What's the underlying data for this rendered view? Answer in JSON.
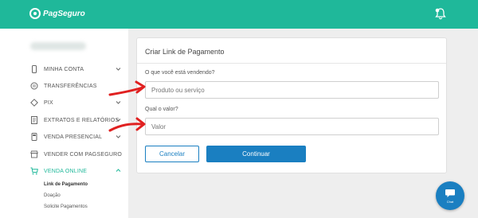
{
  "header": {
    "logo_text": "PagSeguro",
    "accent_color": "#1fb89a",
    "notification_icon": "bell-icon"
  },
  "sidebar": {
    "items": [
      {
        "label": "MINHA CONTA",
        "icon": "phone-icon",
        "has_chevron": true
      },
      {
        "label": "TRANSFERÊNCIAS",
        "icon": "transfer-icon",
        "has_chevron": false
      },
      {
        "label": "PIX",
        "icon": "pix-icon",
        "has_chevron": true
      },
      {
        "label": "EXTRATOS E RELATÓRIOS",
        "icon": "document-icon",
        "has_chevron": true
      },
      {
        "label": "VENDA PRESENCIAL",
        "icon": "card-machine-icon",
        "has_chevron": true
      },
      {
        "label": "VENDER COM PAGSEGURO",
        "icon": "store-icon",
        "has_chevron": false
      },
      {
        "label": "VENDA ONLINE",
        "icon": "cart-icon",
        "has_chevron": true,
        "active": true
      }
    ],
    "sub_items": [
      {
        "label": "Link de Pagamento",
        "active": true
      },
      {
        "label": "Doação"
      },
      {
        "label": "Solicite Pagamentos"
      }
    ]
  },
  "form": {
    "title": "Criar Link de Pagamento",
    "question1": "O que você está vendendo?",
    "field1_placeholder": "Produto ou serviço",
    "question2": "Qual o valor?",
    "field2_placeholder": "Valor",
    "cancel_label": "Cancelar",
    "continue_label": "Continuar",
    "primary_color": "#1a7fc1"
  },
  "chat": {
    "label": "Chat",
    "icon": "chat-icon"
  },
  "annotation_color": "#e02020"
}
